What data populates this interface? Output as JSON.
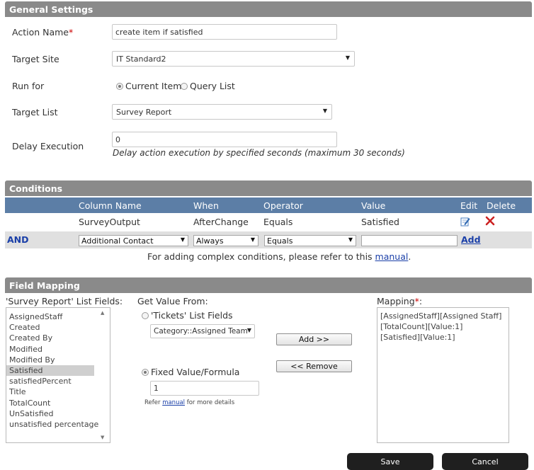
{
  "general": {
    "header": "General Settings",
    "action_name_label": "Action Name",
    "required_mark": "*",
    "action_name_value": "create item if satisfied",
    "target_site_label": "Target Site",
    "target_site_value": "IT Standard2",
    "run_for_label": "Run for",
    "run_for_options": [
      "Current Item",
      "Query List"
    ],
    "run_for_selected": "Current Item",
    "target_list_label": "Target List",
    "target_list_value": "Survey Report",
    "delay_label": "Delay Execution",
    "delay_value": "0",
    "delay_hint": "Delay action execution by specified seconds (maximum 30 seconds)"
  },
  "conditions": {
    "header": "Conditions",
    "columns": [
      "Column Name",
      "When",
      "Operator",
      "Value",
      "Edit",
      "Delete"
    ],
    "rows": [
      {
        "column": "SurveyOutput",
        "when": "AfterChange",
        "operator": "Equals",
        "value": "Satisfied"
      }
    ],
    "new_row": {
      "logic": "AND",
      "column": "Additional Contact",
      "when": "Always",
      "operator": "Equals",
      "value": "",
      "add_label": "Add"
    },
    "note_prefix": "For adding complex conditions, please refer to this",
    "note_link": "manual",
    "note_suffix": "."
  },
  "mapping": {
    "header": "Field Mapping",
    "list_fields_label": "'Survey Report' List Fields:",
    "list_fields": [
      "AssignedStaff",
      "Created",
      "Created By",
      "Modified",
      "Modified By",
      "Satisfied",
      "satisfiedPercent",
      "Title",
      "TotalCount",
      "UnSatisfied",
      "unsatisfied percentage"
    ],
    "selected_field": "Satisfied",
    "get_value_label": "Get Value From:",
    "source_option_label": "'Tickets' List Fields",
    "source_field_value": "Category::Assigned Team",
    "fixed_option_label": "Fixed Value/Formula",
    "fixed_value": "1",
    "refer_prefix": "Refer",
    "refer_link": "manual",
    "refer_suffix": "for more details",
    "add_button": "Add >>",
    "remove_button": "<< Remove",
    "mapping_label": "Mapping",
    "mapping_items": [
      "[AssignedStaff][Assigned Staff]",
      "[TotalCount][Value:1]",
      "[Satisfied][Value:1]"
    ]
  },
  "footer": {
    "save_label": "Save",
    "cancel_label": "Cancel"
  },
  "colors": {
    "section_header": "#8a8a8a",
    "grid_header": "#5c7ea6",
    "required": "#cc0000",
    "delete_icon": "#cc2222",
    "link": "#1a3fa8"
  }
}
